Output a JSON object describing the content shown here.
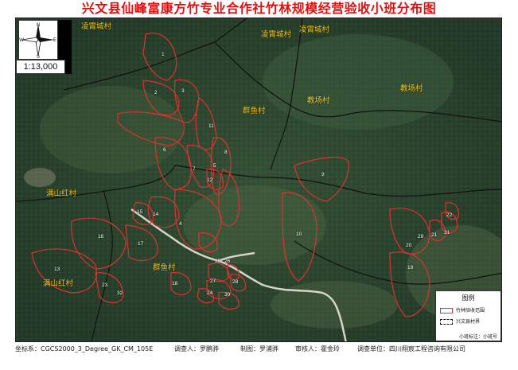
{
  "title": "兴文县仙峰富康方竹专业合作社竹林规模经营验收小班分布图",
  "scale": "1:13,000",
  "compass": {
    "n": "N",
    "s": "S",
    "e": "E",
    "w": "W"
  },
  "villages": [
    {
      "id": "linghe-nw",
      "label": "凌霄城村"
    },
    {
      "id": "linghe-n1",
      "label": "凌霄城村"
    },
    {
      "id": "linghe-n2",
      "label": "凌霄城村"
    },
    {
      "id": "qunyu",
      "label": "群鱼村"
    },
    {
      "id": "jiaochang",
      "label": "教场村"
    },
    {
      "id": "jiaochang-e",
      "label": "教场村"
    },
    {
      "id": "manshan-1",
      "label": "满山红村"
    },
    {
      "id": "manshan-2",
      "label": "满山红村"
    },
    {
      "id": "qunyu-s",
      "label": "群鱼村"
    }
  ],
  "plots": [
    "1",
    "2",
    "3",
    "4",
    "5",
    "6",
    "7",
    "8",
    "9",
    "10",
    "11",
    "12",
    "13",
    "14",
    "15",
    "16",
    "17",
    "18",
    "19",
    "20",
    "21",
    "22",
    "23",
    "24",
    "25",
    "26",
    "27",
    "28",
    "29",
    "30",
    "31",
    "32"
  ],
  "legend": {
    "title": "图例",
    "items": [
      {
        "label": "竹林验收范围"
      },
      {
        "label": "兴文县村界"
      }
    ],
    "note": "小班标注：小班号"
  },
  "footer": {
    "coord": "坐标系：CGCS2000_3_Degree_GK_CM_105E",
    "surveyor": "调查人：罗鹏骅",
    "drafter": "制图：罗浦骅",
    "reviewer": "审核人：霍金玲",
    "org": "调查单位：四川翔宸工程咨询有限公司"
  },
  "colors": {
    "title": "#e01010",
    "plot_border": "#e03030",
    "village_label": "#f0c020",
    "village_border": "#111111"
  }
}
